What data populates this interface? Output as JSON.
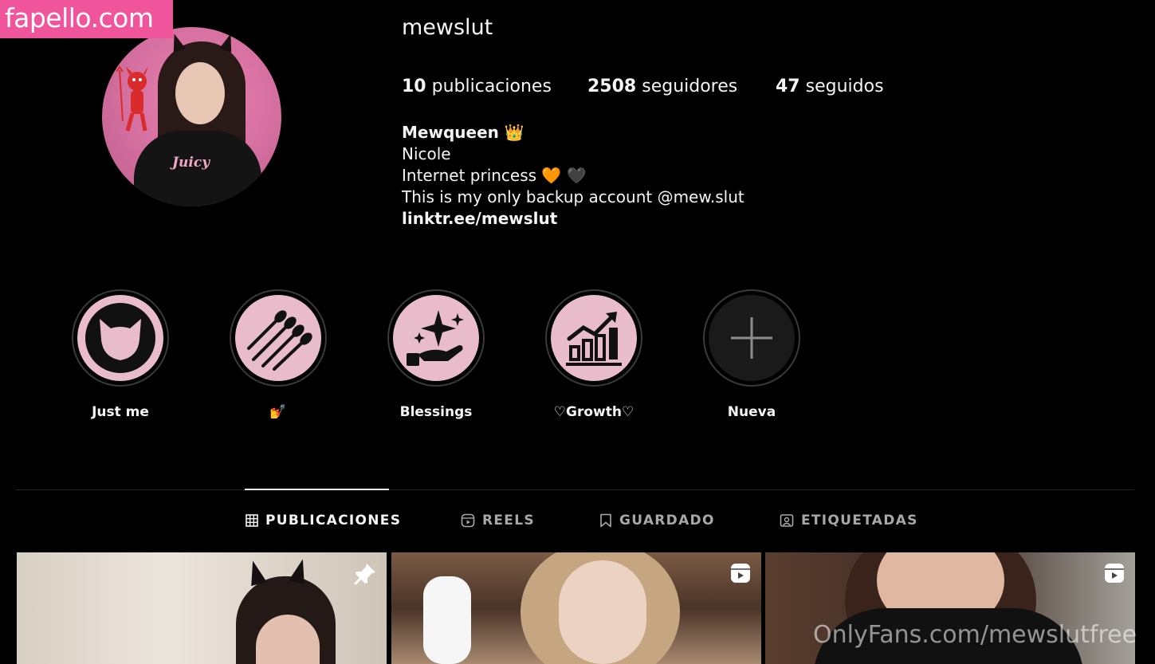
{
  "watermark_site": "fapello.com",
  "watermark_bottom": "OnlyFans.com/mewslutfree",
  "profile": {
    "username": "mewslut",
    "avatar_shirt_text": "Juicy",
    "stats": {
      "posts_count": "10",
      "posts_label": "publicaciones",
      "followers_count": "2508",
      "followers_label": "seguidores",
      "following_count": "47",
      "following_label": "seguidos"
    },
    "bio": {
      "display_name": "Mewqueen 👑",
      "line1": "Nicole",
      "line2": "Internet princess 🧡 🖤",
      "line3": "This is my only backup account @mew.slut",
      "link": "linktr.ee/mewslut"
    }
  },
  "highlights": [
    {
      "label": "Just me",
      "icon": "cat-head-icon"
    },
    {
      "label": "💅",
      "icon": "nails-icon"
    },
    {
      "label": "Blessings",
      "icon": "hand-sparkles-icon"
    },
    {
      "label": "♡Growth♡",
      "icon": "growth-chart-icon"
    },
    {
      "label": "Nueva",
      "icon": "plus-icon"
    }
  ],
  "tabs": [
    {
      "label": "PUBLICACIONES",
      "icon": "grid-icon",
      "active": true
    },
    {
      "label": "REELS",
      "icon": "reels-icon",
      "active": false
    },
    {
      "label": "GUARDADO",
      "icon": "bookmark-icon",
      "active": false
    },
    {
      "label": "ETIQUETADAS",
      "icon": "tagged-icon",
      "active": false
    }
  ],
  "posts": [
    {
      "badge": "pin-icon"
    },
    {
      "badge": "reel-icon"
    },
    {
      "badge": "reel-icon"
    }
  ],
  "colors": {
    "background": "#000000",
    "watermark_pink": "#f0559c",
    "highlight_pink": "#e8bccb",
    "text": "#f5f5f5",
    "muted": "#a8a8a8"
  }
}
